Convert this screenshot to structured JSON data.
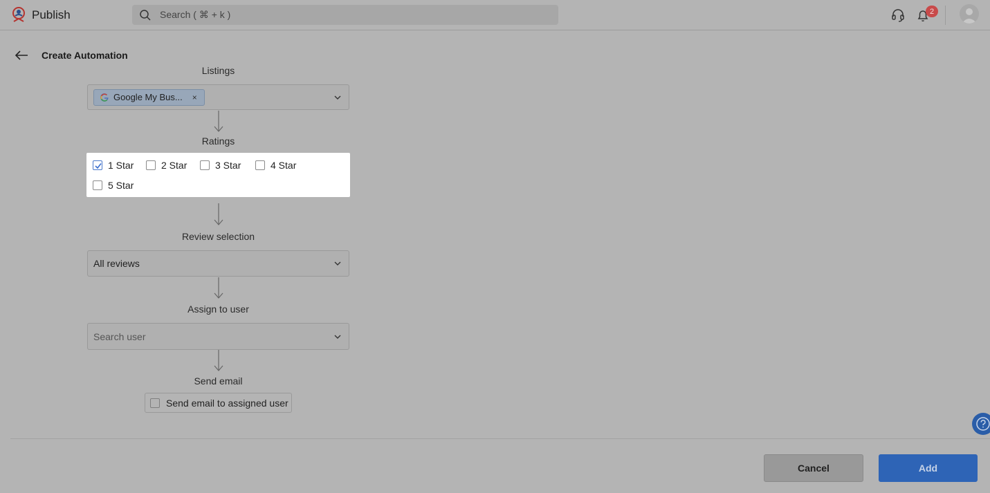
{
  "app": {
    "name": "Publish"
  },
  "search": {
    "placeholder": "Search ( ⌘ + k )"
  },
  "notifications": {
    "count": "2"
  },
  "page": {
    "title": "Create Automation"
  },
  "flow": {
    "listings": {
      "label": "Listings",
      "chip": "Google My Bus...",
      "chip_remove": "×"
    },
    "ratings": {
      "label": "Ratings",
      "options": [
        {
          "label": "1 Star",
          "checked": true
        },
        {
          "label": "2 Star",
          "checked": false
        },
        {
          "label": "3 Star",
          "checked": false
        },
        {
          "label": "4 Star",
          "checked": false
        },
        {
          "label": "5 Star",
          "checked": false
        }
      ]
    },
    "review_selection": {
      "label": "Review selection",
      "value": "All reviews"
    },
    "assign_user": {
      "label": "Assign to user",
      "placeholder": "Search user"
    },
    "send_email": {
      "label": "Send email",
      "option": "Send email to assigned user",
      "checked": false
    }
  },
  "footer": {
    "cancel": "Cancel",
    "add": "Add"
  },
  "colors": {
    "primary": "#2e64b6",
    "badge": "#c84a4a",
    "overlay": "#b4b4b4"
  }
}
